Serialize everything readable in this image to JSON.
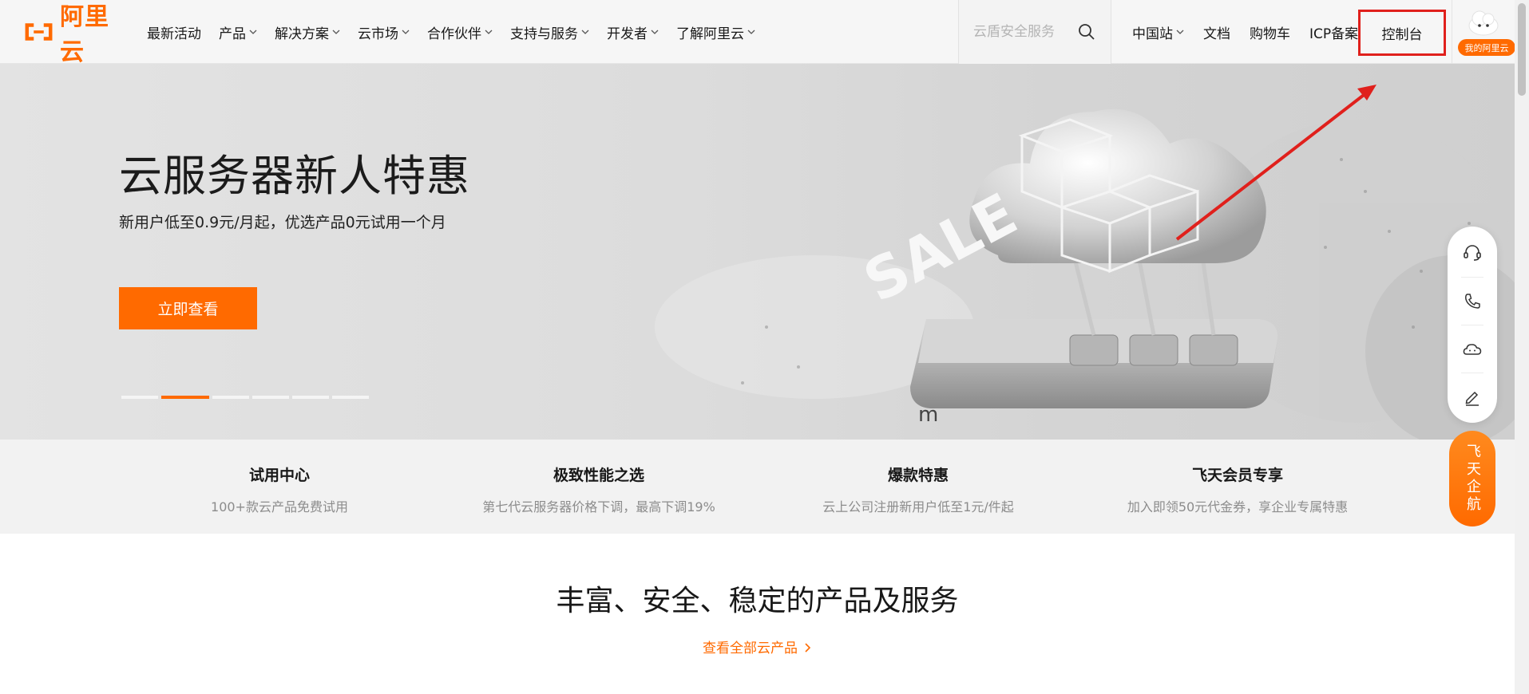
{
  "logo": {
    "text": "阿里云"
  },
  "nav": {
    "items": [
      {
        "label": "最新活动",
        "dropdown": false
      },
      {
        "label": "产品",
        "dropdown": true
      },
      {
        "label": "解决方案",
        "dropdown": true
      },
      {
        "label": "云市场",
        "dropdown": true
      },
      {
        "label": "合作伙伴",
        "dropdown": true
      },
      {
        "label": "支持与服务",
        "dropdown": true
      },
      {
        "label": "开发者",
        "dropdown": true
      },
      {
        "label": "了解阿里云",
        "dropdown": true
      }
    ]
  },
  "search": {
    "placeholder": "云盾安全服务"
  },
  "right_nav": {
    "region": "中国站",
    "docs": "文档",
    "cart": "购物车",
    "icp": "ICP备案",
    "console": "控制台"
  },
  "account": {
    "badge": "我的阿里云"
  },
  "hero": {
    "title": "云服务器新人特惠",
    "subtitle": "新用户低至0.9元/月起，优选产品0元试用一个月",
    "button": "立即查看",
    "art_text": "SALE",
    "slide_count": 6,
    "active_slide": 1
  },
  "features": [
    {
      "title": "试用中心",
      "desc": "100+款云产品免费试用"
    },
    {
      "title": "极致性能之选",
      "desc": "第七代云服务器价格下调，最高下调19%"
    },
    {
      "title": "爆款特惠",
      "desc": "云上公司注册新用户低至1元/件起"
    },
    {
      "title": "飞天会员专享",
      "desc": "加入即领50元代金券，享企业专属特惠"
    }
  ],
  "section": {
    "title": "丰富、安全、稳定的产品及服务",
    "link": "查看全部云产品"
  },
  "float_bar": {
    "icons": [
      "headset-icon",
      "phone-icon",
      "cloud-chat-icon",
      "edit-icon"
    ],
    "feitian_label": "飞天企航"
  },
  "colors": {
    "brand": "#ff6a00",
    "annotation": "#e0201c"
  }
}
